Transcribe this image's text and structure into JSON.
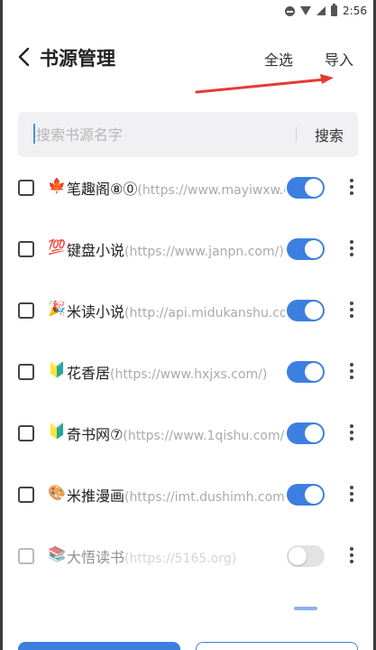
{
  "status_bar": {
    "time": "2:56"
  },
  "toolbar": {
    "title": "书源管理",
    "select_all": "全选",
    "import": "导入"
  },
  "search": {
    "placeholder": "搜索书源名字",
    "button": "搜索"
  },
  "sources": [
    {
      "icon": "maple-leaf-icon",
      "emoji": "🍁",
      "name": "笔趣阁⑧⓪",
      "url": "(https://www.mayiwxw.c...",
      "enabled": true
    },
    {
      "icon": "hundred-points-icon",
      "emoji": "💯",
      "name": "键盘小说",
      "url": "(https://www.janpn.com/)",
      "enabled": true
    },
    {
      "icon": "party-popper-icon",
      "emoji": "🎉",
      "name": "米读小说",
      "url": "(http://api.midukanshu.co...",
      "enabled": true
    },
    {
      "icon": "beginner-badge-icon",
      "emoji": "🔰",
      "name": "花香居",
      "url": "(https://www.hxjxs.com/)",
      "enabled": true
    },
    {
      "icon": "beginner-badge-icon",
      "emoji": "🔰",
      "name": "奇书网⑦",
      "url": "(https://www.1qishu.com/)",
      "enabled": true
    },
    {
      "icon": "artist-palette-icon",
      "emoji": "🎨",
      "name": "米推漫画",
      "url": "(https://imt.dushimh.com)",
      "enabled": true
    },
    {
      "icon": "books-icon",
      "emoji": "📚",
      "name": "大悟读书",
      "url": "(https://5165.org)",
      "enabled": false
    }
  ],
  "colors": {
    "accent": "#3d7fe0",
    "annotation_arrow": "#e53935"
  }
}
